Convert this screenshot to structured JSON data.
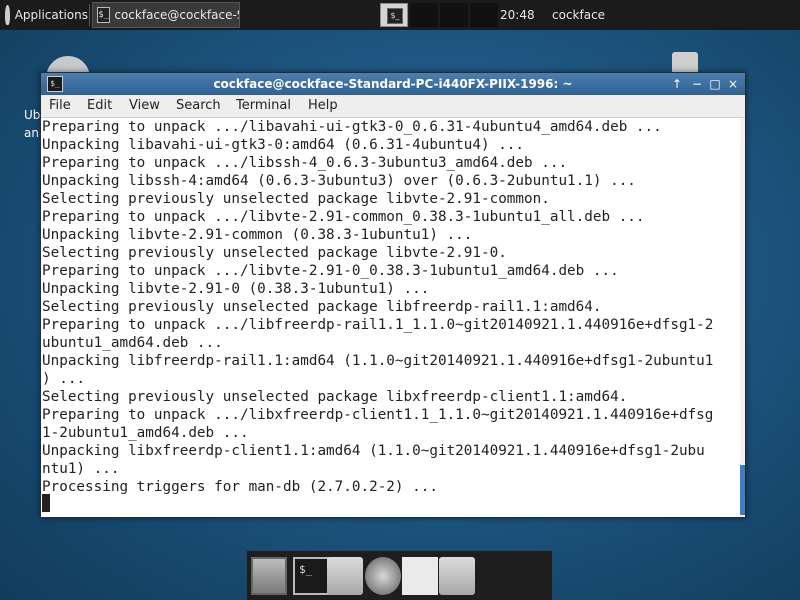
{
  "top_panel": {
    "applications_label": "Applications",
    "task_label": "cockface@cockface-Sta...",
    "task_icon_glyph": "$_",
    "clock": "20:48",
    "user": "cockface"
  },
  "desktop": {
    "left_label": "Ub\nan"
  },
  "window": {
    "title": "cockface@cockface-Standard-PC-i440FX-PIIX-1996: ~",
    "icon_glyph": "$_",
    "controls": [
      "↑",
      "−",
      "□",
      "×"
    ],
    "menu": [
      "File",
      "Edit",
      "View",
      "Search",
      "Terminal",
      "Help"
    ],
    "terminal_lines": [
      "Preparing to unpack .../libavahi-ui-gtk3-0_0.6.31-4ubuntu4_amd64.deb ...",
      "Unpacking libavahi-ui-gtk3-0:amd64 (0.6.31-4ubuntu4) ...",
      "Preparing to unpack .../libssh-4_0.6.3-3ubuntu3_amd64.deb ...",
      "Unpacking libssh-4:amd64 (0.6.3-3ubuntu3) over (0.6.3-2ubuntu1.1) ...",
      "Selecting previously unselected package libvte-2.91-common.",
      "Preparing to unpack .../libvte-2.91-common_0.38.3-1ubuntu1_all.deb ...",
      "Unpacking libvte-2.91-common (0.38.3-1ubuntu1) ...",
      "Selecting previously unselected package libvte-2.91-0.",
      "Preparing to unpack .../libvte-2.91-0_0.38.3-1ubuntu1_amd64.deb ...",
      "Unpacking libvte-2.91-0 (0.38.3-1ubuntu1) ...",
      "Selecting previously unselected package libfreerdp-rail1.1:amd64.",
      "Preparing to unpack .../libfreerdp-rail1.1_1.1.0~git20140921.1.440916e+dfsg1-2",
      "ubuntu1_amd64.deb ...",
      "Unpacking libfreerdp-rail1.1:amd64 (1.1.0~git20140921.1.440916e+dfsg1-2ubuntu1",
      ") ...",
      "Selecting previously unselected package libxfreerdp-client1.1:amd64.",
      "Preparing to unpack .../libxfreerdp-client1.1_1.1.0~git20140921.1.440916e+dfsg",
      "1-2ubuntu1_amd64.deb ...",
      "Unpacking libxfreerdp-client1.1:amd64 (1.1.0~git20140921.1.440916e+dfsg1-2ubu",
      "ntu1) ...",
      "Processing triggers for man-db (2.7.0.2-2) ..."
    ]
  },
  "dock": {
    "terminal_glyph": "$_"
  },
  "colors": {
    "titlebar": "#3a6fa0",
    "desktop": "#1f5a86",
    "scroll_thumb": "#3c7fc4"
  }
}
